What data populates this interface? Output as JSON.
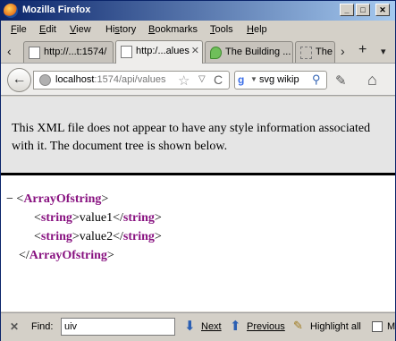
{
  "window": {
    "title": "Mozilla Firefox",
    "minimize_glyph": "_",
    "maximize_glyph": "□",
    "close_glyph": "✕"
  },
  "menubar": {
    "items": [
      {
        "label": "File",
        "underline": "F",
        "rest": "ile"
      },
      {
        "label": "Edit",
        "underline": "E",
        "rest": "dit"
      },
      {
        "label": "View",
        "underline": "V",
        "rest": "iew"
      },
      {
        "label": "History",
        "underline": "",
        "pre": "Hi",
        "u": "s",
        "post": "tory"
      },
      {
        "label": "Bookmarks",
        "underline": "B",
        "rest": "ookmarks"
      },
      {
        "label": "Tools",
        "underline": "T",
        "rest": "ools"
      },
      {
        "label": "Help",
        "underline": "H",
        "rest": "elp"
      }
    ]
  },
  "tabs": [
    {
      "label": "http://...t:1574/",
      "icon": "page-icon",
      "active": false
    },
    {
      "label": "http:/...alues",
      "icon": "page-icon",
      "active": true,
      "close": "✕"
    },
    {
      "label": "The Building ...",
      "icon": "speech-bubble-icon",
      "active": false
    },
    {
      "label": "The",
      "icon": "blank-page-icon",
      "active": false
    }
  ],
  "tabnav": {
    "scroll_right": "›",
    "new_tab": "+",
    "list": "▾"
  },
  "navbar": {
    "back_glyph": "←",
    "url_host": "localhost",
    "url_rest": ":1574/api/values",
    "star_glyph": "☆",
    "drop_glyph": "▽",
    "reload_glyph": "C",
    "search_engine": "g",
    "search_value": "svg wikip",
    "search_glyph": "⚲",
    "addon_glyph": "✎",
    "home_glyph": "⌂"
  },
  "content": {
    "notice": "This XML file does not appear to have any style information associated with it. The document tree is shown below.",
    "tree": [
      {
        "collapse": "−",
        "open": "<",
        "tag": "ArrayOfstring",
        "close": ">"
      },
      {
        "open": "<",
        "tag": "string",
        "mid": ">value1</",
        "tag2": "string",
        "close": ">"
      },
      {
        "open": "<",
        "tag": "string",
        "mid": ">value2</",
        "tag2": "string",
        "close": ">"
      },
      {
        "open": "</",
        "tag": "ArrayOfstring",
        "close": ">"
      }
    ]
  },
  "findbar": {
    "close_glyph": "✕",
    "label": "Find:",
    "value": "uiv",
    "next_label": "Next",
    "prev_label": "Previous",
    "highlight_label": "Highlight all",
    "match_case_label": "M"
  }
}
